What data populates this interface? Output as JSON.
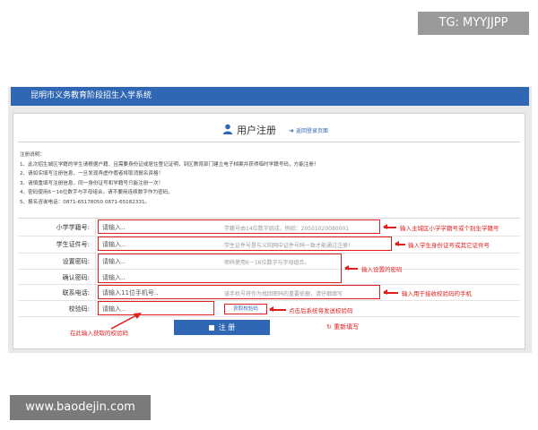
{
  "watermarks": {
    "top_right": "TG: MYYJJPP",
    "bottom_left": "www.baodejin.com"
  },
  "header": {
    "title": "昆明市义务教育阶段招生入学系统"
  },
  "page": {
    "title": "用户注册",
    "back_link": "返回登录页面",
    "user_icon": "user-icon"
  },
  "notes": {
    "heading": "注册说明：",
    "items": [
      "1、此次招生城区学籍的学生请根据户籍、且需要身份证或居住登记证明，到区教育部门建立电子档案并获得临时学籍号码，方能注册！",
      "2、请如实填写注册信息，一旦发现弄虚作假者将取消报名资格！",
      "3、请慎重填写注册信息，同一身份证号和学籍号只能注册一次！",
      "4、密码使用6－16位数字与字母组合，请不要用连续数字作为密码。",
      "5、报名咨询电话：0871-65178050 0871-65182331。"
    ]
  },
  "form": {
    "rows": [
      {
        "label": "小学学籍号:",
        "placeholder": "请输入..",
        "hint": "学籍号由14位数字组成，例如：20501020080001"
      },
      {
        "label": "学生证件号:",
        "placeholder": "请输入..",
        "hint": "学生证件号是与义阳网中证件号码一致才能通过注册！"
      },
      {
        "label": "设置密码:",
        "placeholder": "请输入..",
        "hint": "密码使用6－16位数字与字母组合。"
      },
      {
        "label": "确认密码:",
        "placeholder": "请输入..",
        "hint": ""
      },
      {
        "label": "联系电话:",
        "placeholder": "请输入11位手机号..",
        "hint": "该手机号将作为找回密码的重要依据，请仔细填写"
      },
      {
        "label": "校验码:",
        "placeholder": "请输入..",
        "hint": ""
      }
    ],
    "captcha_button": "获取校验码",
    "register_button": "注 册",
    "reset_link": "重新填写"
  },
  "annotations": {
    "student_no": "输入主城区小学学籍号或个别生学籍号",
    "id_no": "输入学生身份证号或其它证件号",
    "password": "输入设置的密码",
    "phone": "输入用于接收校验码的手机",
    "captcha": "点击后系统将发送校验码",
    "captcha_input": "在此输入获取的校验码"
  },
  "colors": {
    "header": "#2f67b4",
    "accent_red": "#e01e1e"
  }
}
